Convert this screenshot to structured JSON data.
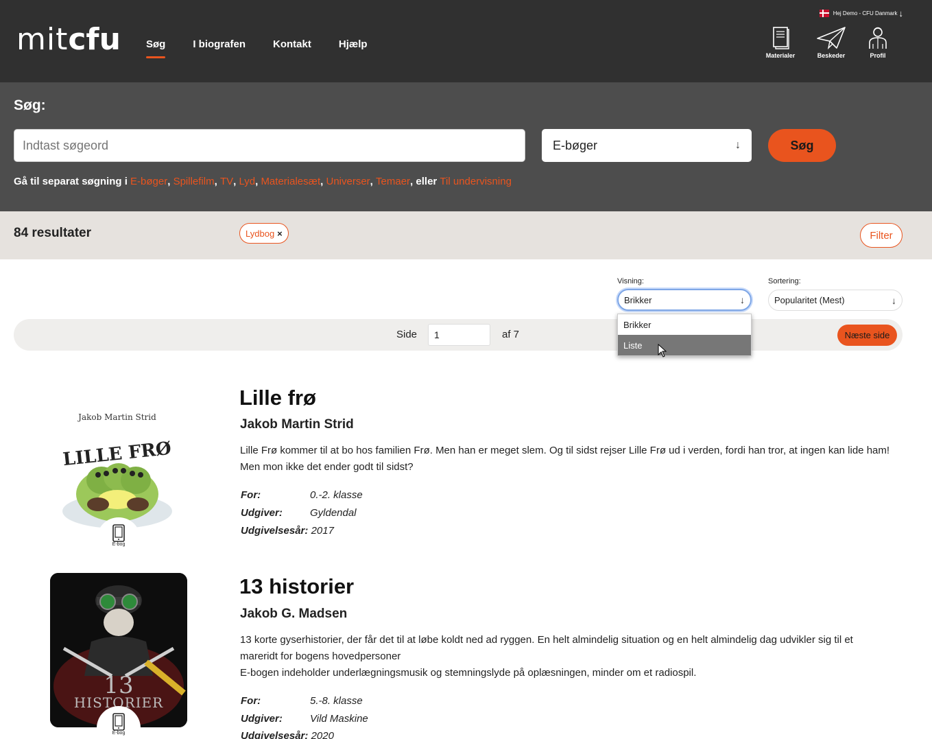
{
  "header": {
    "logo_mit": "mit",
    "logo_cfu": "cfu",
    "nav": [
      {
        "label": "Søg",
        "active": true
      },
      {
        "label": "I biografen",
        "active": false
      },
      {
        "label": "Kontakt",
        "active": false
      },
      {
        "label": "Hjælp",
        "active": false
      }
    ],
    "user_greeting": "Hej Demo - CFU Danmark",
    "icons": [
      {
        "label": "Materialer",
        "icon": "book-icon"
      },
      {
        "label": "Beskeder",
        "icon": "paper-plane-icon"
      },
      {
        "label": "Profil",
        "icon": "person-icon"
      }
    ]
  },
  "search": {
    "title": "Søg:",
    "placeholder": "Indtast søgeord",
    "type_selected": "E-bøger",
    "button_label": "Søg",
    "separate_prefix": "Gå til separat søgning i",
    "separate_links": [
      "E-bøger",
      "Spillefilm",
      "TV",
      "Lyd",
      "Materialesæt",
      "Universer",
      "Temaer"
    ],
    "separate_or": "eller",
    "separate_last": "Til undervisning"
  },
  "results_bar": {
    "count": "84 resultater",
    "chip_label": "Lydbog",
    "chip_remove": "×",
    "filter_label": "Filter"
  },
  "controls": {
    "view_label": "Visning:",
    "view_selected": "Brikker",
    "view_options": [
      "Brikker",
      "Liste"
    ],
    "view_hovered": "Liste",
    "sort_label": "Sortering:",
    "sort_selected": "Popularitet (Mest)"
  },
  "pager": {
    "side_label": "Side",
    "page_value": "1",
    "af_label": "af 7",
    "next_label": "Næste side"
  },
  "results": [
    {
      "title": "Lille frø",
      "author": "Jakob Martin Strid",
      "description": "Lille Frø kommer til at bo hos familien Frø. Men han er meget slem. Og til sidst rejser Lille Frø ud i verden, fordi han tror, at ingen kan lide ham! Men mon ikke det ender godt til sidst?",
      "cover_author": "Jakob Martin Strid",
      "cover_title": "LILLE FRØ",
      "badge": "E-bog",
      "meta": [
        {
          "label": "For:",
          "value": "0.-2. klasse"
        },
        {
          "label": "Udgiver:",
          "value": "Gyldendal"
        },
        {
          "label": "Udgivelsesår:",
          "value": "2017"
        }
      ]
    },
    {
      "title": "13 historier",
      "author": "Jakob G. Madsen",
      "description_lines": [
        "13 korte gyserhistorier, der får det til at løbe koldt ned ad ryggen. En helt almindelig situation og en helt almindelig dag udvikler sig til et mareridt for bogens hovedpersoner",
        "E-bogen indeholder underlægningsmusik og stemningslyde på oplæsningen, minder om et radiospil."
      ],
      "cover_title_top": "13",
      "cover_title_bottom": "HISTORIER",
      "badge": "E-bog",
      "meta": [
        {
          "label": "For:",
          "value": "5.-8. klasse"
        },
        {
          "label": "Udgiver:",
          "value": "Vild Maskine"
        },
        {
          "label": "Udgivelsesår:",
          "value": "2020"
        }
      ]
    }
  ],
  "colors": {
    "accent": "#e9541e",
    "header_bg": "#303030",
    "search_bg": "#4d4d4d",
    "results_bar_bg": "#e6e2de"
  }
}
